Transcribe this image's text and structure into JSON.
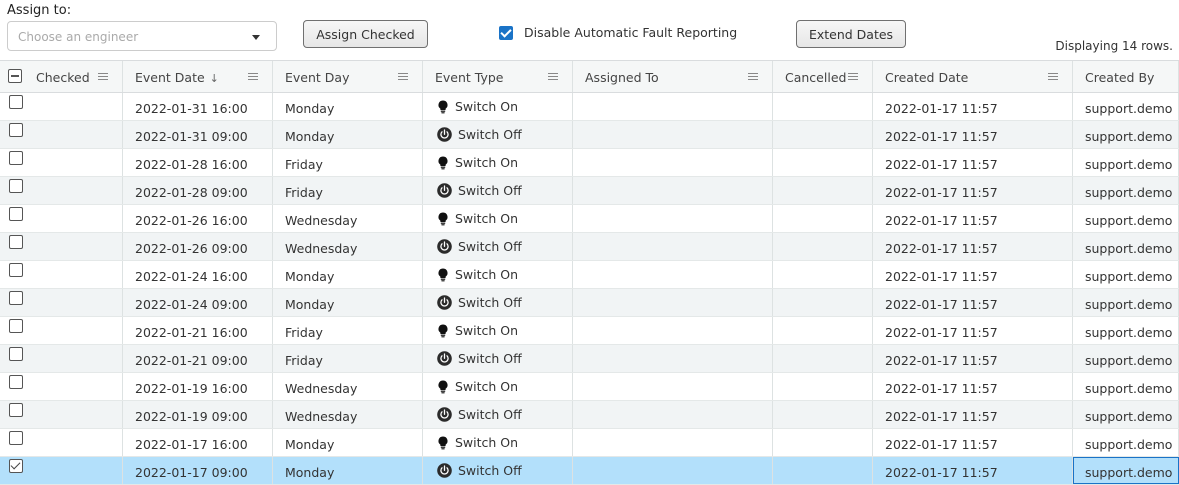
{
  "toolbar": {
    "assign_label": "Assign to:",
    "engineer_placeholder": "Choose an engineer",
    "assign_button": "Assign Checked",
    "disable_fault_label": "Disable Automatic Fault Reporting",
    "disable_fault_checked": true,
    "extend_button": "Extend Dates",
    "row_count": "Displaying 14 rows."
  },
  "columns": [
    {
      "key": "checked",
      "label": "Checked"
    },
    {
      "key": "event_date",
      "label": "Event Date",
      "sort": "↓"
    },
    {
      "key": "event_day",
      "label": "Event Day"
    },
    {
      "key": "event_type",
      "label": "Event Type"
    },
    {
      "key": "assigned_to",
      "label": "Assigned To"
    },
    {
      "key": "cancelled",
      "label": "Cancelled"
    },
    {
      "key": "created_date",
      "label": "Created Date"
    },
    {
      "key": "created_by",
      "label": "Created By"
    }
  ],
  "icons": {
    "switch_on": "lightbulb-icon",
    "switch_off": "power-icon",
    "column_menu": "menu-icon"
  },
  "colors": {
    "accent": "#1a73c7",
    "selected_row": "#b3e0fb",
    "alt_row": "#f1f4f5"
  },
  "rows": [
    {
      "checked": false,
      "event_date": "2022-01-31 16:00",
      "event_day": "Monday",
      "event_type": "Switch On",
      "assigned_to": "",
      "cancelled": "",
      "created_date": "2022-01-17 11:57",
      "created_by": "support.demo"
    },
    {
      "checked": false,
      "event_date": "2022-01-31 09:00",
      "event_day": "Monday",
      "event_type": "Switch Off",
      "assigned_to": "",
      "cancelled": "",
      "created_date": "2022-01-17 11:57",
      "created_by": "support.demo"
    },
    {
      "checked": false,
      "event_date": "2022-01-28 16:00",
      "event_day": "Friday",
      "event_type": "Switch On",
      "assigned_to": "",
      "cancelled": "",
      "created_date": "2022-01-17 11:57",
      "created_by": "support.demo"
    },
    {
      "checked": false,
      "event_date": "2022-01-28 09:00",
      "event_day": "Friday",
      "event_type": "Switch Off",
      "assigned_to": "",
      "cancelled": "",
      "created_date": "2022-01-17 11:57",
      "created_by": "support.demo"
    },
    {
      "checked": false,
      "event_date": "2022-01-26 16:00",
      "event_day": "Wednesday",
      "event_type": "Switch On",
      "assigned_to": "",
      "cancelled": "",
      "created_date": "2022-01-17 11:57",
      "created_by": "support.demo"
    },
    {
      "checked": false,
      "event_date": "2022-01-26 09:00",
      "event_day": "Wednesday",
      "event_type": "Switch Off",
      "assigned_to": "",
      "cancelled": "",
      "created_date": "2022-01-17 11:57",
      "created_by": "support.demo"
    },
    {
      "checked": false,
      "event_date": "2022-01-24 16:00",
      "event_day": "Monday",
      "event_type": "Switch On",
      "assigned_to": "",
      "cancelled": "",
      "created_date": "2022-01-17 11:57",
      "created_by": "support.demo"
    },
    {
      "checked": false,
      "event_date": "2022-01-24 09:00",
      "event_day": "Monday",
      "event_type": "Switch Off",
      "assigned_to": "",
      "cancelled": "",
      "created_date": "2022-01-17 11:57",
      "created_by": "support.demo"
    },
    {
      "checked": false,
      "event_date": "2022-01-21 16:00",
      "event_day": "Friday",
      "event_type": "Switch On",
      "assigned_to": "",
      "cancelled": "",
      "created_date": "2022-01-17 11:57",
      "created_by": "support.demo"
    },
    {
      "checked": false,
      "event_date": "2022-01-21 09:00",
      "event_day": "Friday",
      "event_type": "Switch Off",
      "assigned_to": "",
      "cancelled": "",
      "created_date": "2022-01-17 11:57",
      "created_by": "support.demo"
    },
    {
      "checked": false,
      "event_date": "2022-01-19 16:00",
      "event_day": "Wednesday",
      "event_type": "Switch On",
      "assigned_to": "",
      "cancelled": "",
      "created_date": "2022-01-17 11:57",
      "created_by": "support.demo"
    },
    {
      "checked": false,
      "event_date": "2022-01-19 09:00",
      "event_day": "Wednesday",
      "event_type": "Switch Off",
      "assigned_to": "",
      "cancelled": "",
      "created_date": "2022-01-17 11:57",
      "created_by": "support.demo"
    },
    {
      "checked": false,
      "event_date": "2022-01-17 16:00",
      "event_day": "Monday",
      "event_type": "Switch On",
      "assigned_to": "",
      "cancelled": "",
      "created_date": "2022-01-17 11:57",
      "created_by": "support.demo"
    },
    {
      "checked": true,
      "event_date": "2022-01-17 09:00",
      "event_day": "Monday",
      "event_type": "Switch Off",
      "assigned_to": "",
      "cancelled": "",
      "created_date": "2022-01-17 11:57",
      "created_by": "support.demo",
      "selected": true
    }
  ]
}
